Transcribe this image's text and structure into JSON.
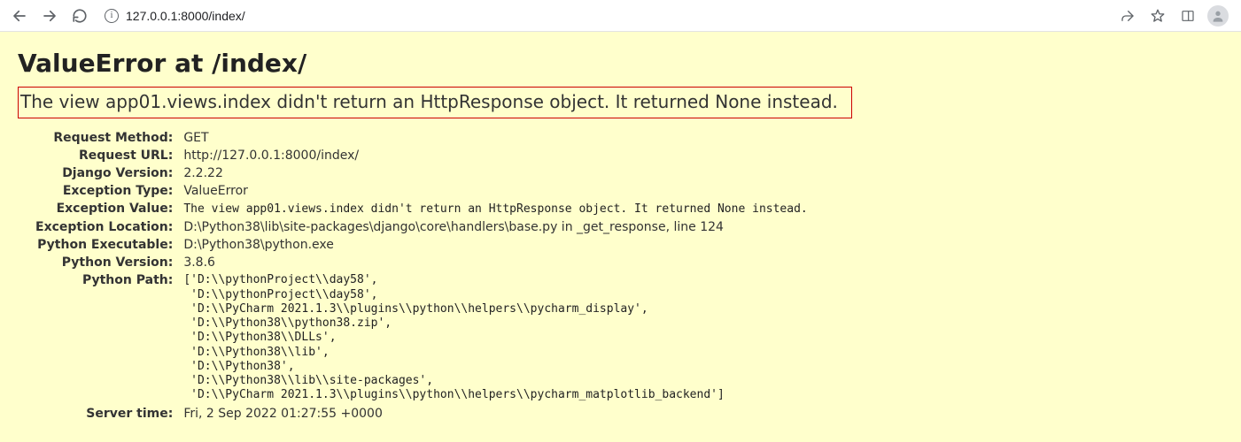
{
  "browser": {
    "url": "127.0.0.1:8000/index/"
  },
  "django": {
    "heading": "ValueError at /index/",
    "exception_message": "The view app01.views.index didn't return an HttpResponse object. It returned None instead.",
    "rows": {
      "request_method": {
        "label": "Request Method:",
        "value": "GET"
      },
      "request_url": {
        "label": "Request URL:",
        "value": "http://127.0.0.1:8000/index/"
      },
      "django_version": {
        "label": "Django Version:",
        "value": "2.2.22"
      },
      "exception_type": {
        "label": "Exception Type:",
        "value": "ValueError"
      },
      "exception_value": {
        "label": "Exception Value:",
        "value": "The view app01.views.index didn't return an HttpResponse object. It returned None instead."
      },
      "exception_location": {
        "label": "Exception Location:",
        "value": "D:\\Python38\\lib\\site-packages\\django\\core\\handlers\\base.py in _get_response, line 124"
      },
      "python_executable": {
        "label": "Python Executable:",
        "value": "D:\\Python38\\python.exe"
      },
      "python_version": {
        "label": "Python Version:",
        "value": "3.8.6"
      },
      "python_path": {
        "label": "Python Path:",
        "value": "['D:\\\\pythonProject\\\\day58',\n 'D:\\\\pythonProject\\\\day58',\n 'D:\\\\PyCharm 2021.1.3\\\\plugins\\\\python\\\\helpers\\\\pycharm_display',\n 'D:\\\\Python38\\\\python38.zip',\n 'D:\\\\Python38\\\\DLLs',\n 'D:\\\\Python38\\\\lib',\n 'D:\\\\Python38',\n 'D:\\\\Python38\\\\lib\\\\site-packages',\n 'D:\\\\PyCharm 2021.1.3\\\\plugins\\\\python\\\\helpers\\\\pycharm_matplotlib_backend']"
      },
      "server_time": {
        "label": "Server time:",
        "value": "Fri, 2 Sep 2022 01:27:55 +0000"
      }
    }
  }
}
